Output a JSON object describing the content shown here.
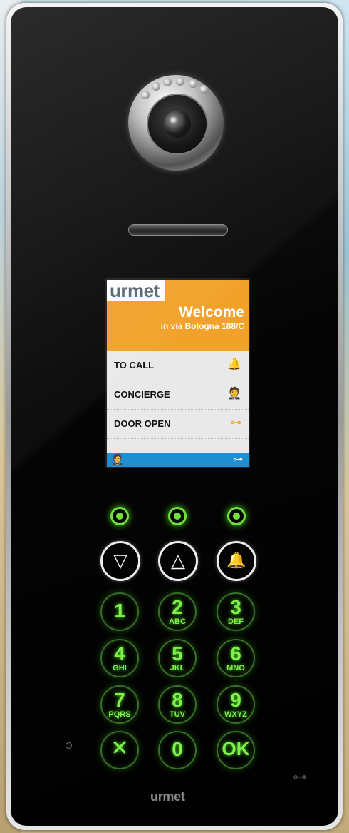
{
  "screen": {
    "brand": "urmet",
    "welcome": "Welcome",
    "address": "in via Bologna 188/C",
    "menu": [
      {
        "label": "TO CALL",
        "icon": "bell-icon",
        "glyph": "🔔"
      },
      {
        "label": "CONCIERGE",
        "icon": "concierge-icon",
        "glyph": "🤵"
      },
      {
        "label": "DOOR OPEN",
        "icon": "key-icon",
        "glyph": "⊶"
      }
    ],
    "footer": {
      "left_icon": "concierge-icon",
      "left_glyph": "🤵",
      "right_icon": "key-icon",
      "right_glyph": "⊶"
    }
  },
  "keypad": {
    "nav": [
      {
        "name": "scroll-down-button",
        "icon": "triangle-down-icon",
        "glyph": "▽"
      },
      {
        "name": "scroll-up-button",
        "icon": "triangle-up-icon",
        "glyph": "△"
      },
      {
        "name": "call-button",
        "icon": "bell-icon",
        "glyph": "🔔"
      }
    ],
    "keys": [
      {
        "num": "1",
        "letters": ""
      },
      {
        "num": "2",
        "letters": "ABC"
      },
      {
        "num": "3",
        "letters": "DEF"
      },
      {
        "num": "4",
        "letters": "GHI"
      },
      {
        "num": "5",
        "letters": "JKL"
      },
      {
        "num": "6",
        "letters": "MNO"
      },
      {
        "num": "7",
        "letters": "PQRS"
      },
      {
        "num": "8",
        "letters": "TUV"
      },
      {
        "num": "9",
        "letters": "WXYZ"
      },
      {
        "num": "✕",
        "letters": ""
      },
      {
        "num": "0",
        "letters": ""
      },
      {
        "num": "OK",
        "letters": ""
      }
    ]
  },
  "footer_brand": "urmet",
  "colors": {
    "accent": "#f2a12a",
    "status_bar": "#1f8fd1",
    "key_glow": "#6ee23b"
  }
}
